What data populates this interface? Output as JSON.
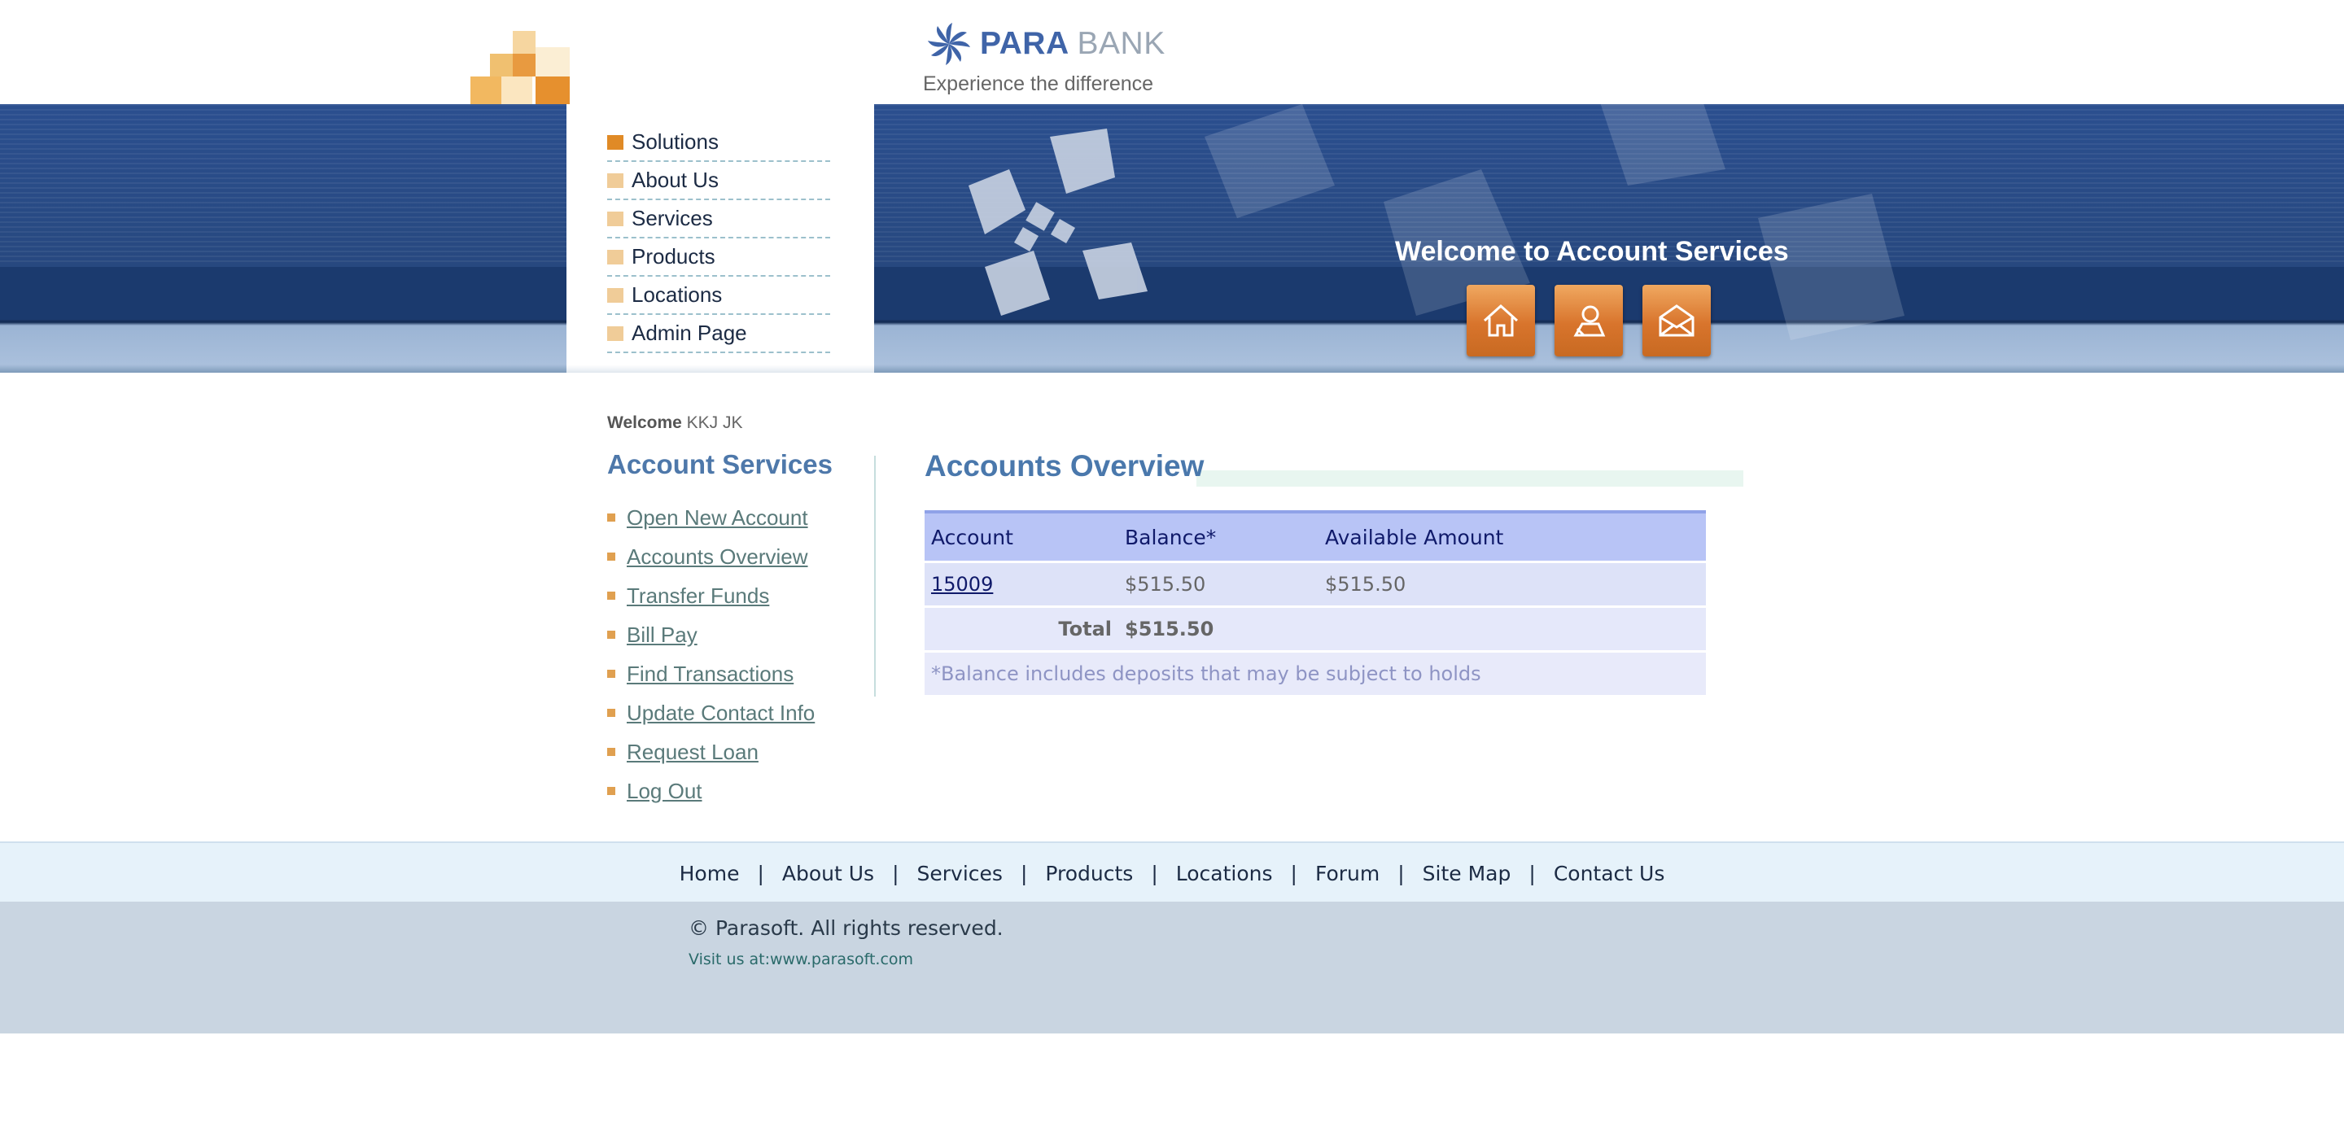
{
  "brand": {
    "name_part1": "PARA",
    "name_part2": "BANK",
    "tagline": "Experience the difference"
  },
  "top_menu": [
    {
      "label": "Solutions"
    },
    {
      "label": "About Us"
    },
    {
      "label": "Services"
    },
    {
      "label": "Products"
    },
    {
      "label": "Locations"
    },
    {
      "label": "Admin Page"
    }
  ],
  "header": {
    "welcome_banner": "Welcome to Account Services",
    "buttons": [
      "home-icon",
      "contact-icon",
      "email-icon"
    ]
  },
  "welcome": {
    "label": "Welcome",
    "name": "KKJ JK"
  },
  "account_services": {
    "title": "Account Services",
    "items": [
      {
        "label": "Open New Account"
      },
      {
        "label": "Accounts Overview"
      },
      {
        "label": "Transfer Funds"
      },
      {
        "label": "Bill Pay"
      },
      {
        "label": "Find Transactions"
      },
      {
        "label": "Update Contact Info"
      },
      {
        "label": "Request Loan"
      },
      {
        "label": "Log Out"
      }
    ]
  },
  "overview": {
    "title": "Accounts Overview",
    "headers": [
      "Account",
      "Balance*",
      "Available Amount"
    ],
    "rows": [
      {
        "account": "15009",
        "balance": "$515.50",
        "available": "$515.50"
      }
    ],
    "total_label": "Total",
    "total_value": "$515.50",
    "note": "*Balance includes deposits that may be subject to holds"
  },
  "footer": {
    "links": [
      "Home",
      "About Us",
      "Services",
      "Products",
      "Locations",
      "Forum",
      "Site Map",
      "Contact Us"
    ],
    "separator": "|",
    "copyright": "© Parasoft. All rights reserved.",
    "visit": "Visit us at:www.parasoft.com"
  },
  "colors": {
    "accent_orange": "#e08a26",
    "brand_blue": "#3f64a8",
    "banner_blue": "#27487f",
    "table_header": "#b8c4f6"
  }
}
